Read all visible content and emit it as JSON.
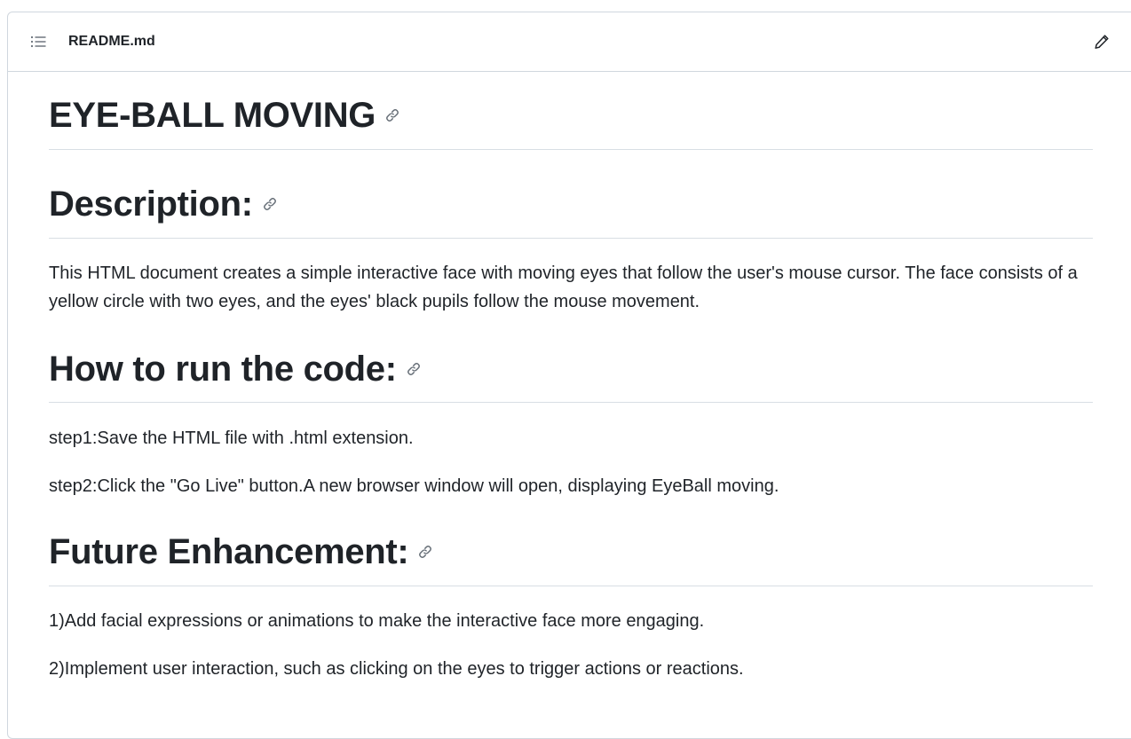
{
  "header": {
    "file_name": "README.md"
  },
  "readme": {
    "title": "EYE-BALL MOVING",
    "description_heading": "Description:",
    "description_text": "This HTML document creates a simple interactive face with moving eyes that follow the user's mouse cursor. The face consists of a yellow circle with two eyes, and the eyes' black pupils follow the mouse movement.",
    "run_heading": "How to run the code:",
    "run_steps": [
      "step1:Save the HTML file with .html extension.",
      "step2:Click the \"Go Live\" button.A new browser window will open, displaying EyeBall moving."
    ],
    "future_heading": "Future Enhancement:",
    "future_items": [
      "1)Add facial expressions or animations to make the interactive face more engaging.",
      "2)Implement user interaction, such as clicking on the eyes to trigger actions or reactions."
    ]
  },
  "icons": {
    "outline": "list-outline-icon",
    "edit": "pencil-icon",
    "anchor": "link-icon"
  },
  "colors": {
    "text": "#1f2328",
    "border": "#d0d7de",
    "icon": "#656d76"
  }
}
